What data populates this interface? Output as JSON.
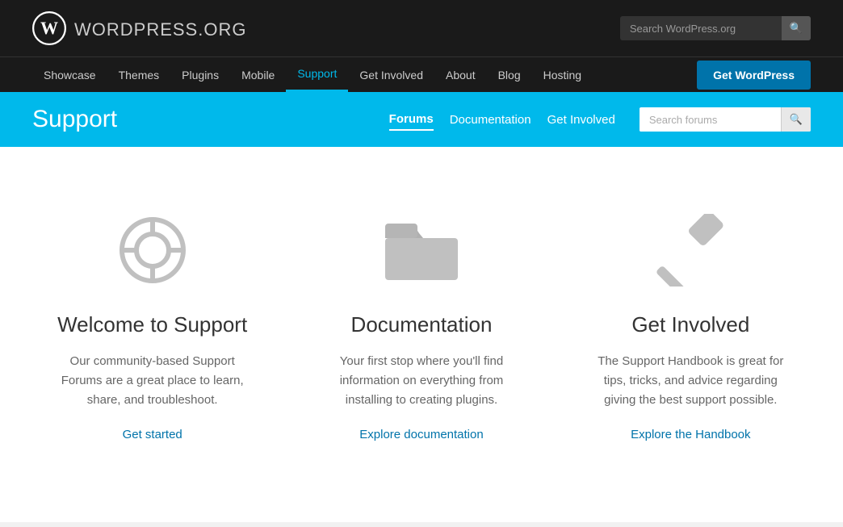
{
  "site": {
    "logo_text": "WordPress",
    "logo_suffix": ".org",
    "search_placeholder": "Search WordPress.org"
  },
  "primary_nav": {
    "items": [
      {
        "label": "Showcase",
        "active": false
      },
      {
        "label": "Themes",
        "active": false
      },
      {
        "label": "Plugins",
        "active": false
      },
      {
        "label": "Mobile",
        "active": false
      },
      {
        "label": "Support",
        "active": true
      },
      {
        "label": "Get Involved",
        "active": false
      },
      {
        "label": "About",
        "active": false
      },
      {
        "label": "Blog",
        "active": false
      },
      {
        "label": "Hosting",
        "active": false
      }
    ],
    "cta_label": "Get WordPress"
  },
  "support_bar": {
    "title": "Support",
    "nav_items": [
      {
        "label": "Forums",
        "active": true
      },
      {
        "label": "Documentation",
        "active": false
      },
      {
        "label": "Get Involved",
        "active": false
      }
    ],
    "search_placeholder": "Search forums"
  },
  "cards": [
    {
      "icon": "lifesaver",
      "title": "Welcome to Support",
      "description": "Our community-based Support Forums are a great place to learn, share, and troubleshoot.",
      "link_label": "Get started",
      "link_url": "#"
    },
    {
      "icon": "folder",
      "title": "Documentation",
      "description": "Your first stop where you'll find information on everything from installing to creating plugins.",
      "link_label": "Explore documentation",
      "link_url": "#"
    },
    {
      "icon": "hammer",
      "title": "Get Involved",
      "description": "The Support Handbook is great for tips, tricks, and advice regarding giving the best support possible.",
      "link_label": "Explore the Handbook",
      "link_url": "#"
    }
  ]
}
